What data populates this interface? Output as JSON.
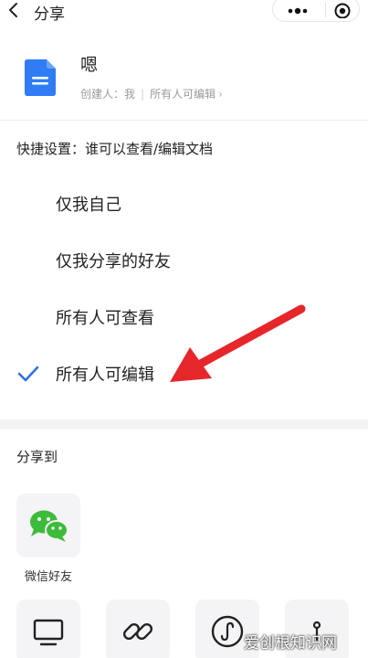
{
  "nav": {
    "title": "分享",
    "back_icon": "chevron-left-icon",
    "more_icon": "more-dots-icon",
    "close_icon": "target-circle-icon"
  },
  "document": {
    "name": "嗯",
    "icon": "doc-file-icon",
    "creator": "创建人：我",
    "permission_summary": "所有人可编辑",
    "colors": {
      "icon_blue": "#2f7cf5",
      "icon_blue_light": "#6aa4ff"
    }
  },
  "quick_settings": {
    "title": "快捷设置：谁可以查看/编辑文档",
    "options": [
      {
        "label": "仅我自己",
        "selected": false
      },
      {
        "label": "仅我分享的好友",
        "selected": false
      },
      {
        "label": "所有人可查看",
        "selected": false
      },
      {
        "label": "所有人可编辑",
        "selected": true
      }
    ],
    "check_color": "#2f6fe8",
    "annotation_arrow_color": "#e5262b"
  },
  "share_to": {
    "title": "分享到",
    "targets": [
      {
        "label": "微信好友",
        "icon": "wechat-icon",
        "color": "#3dbb3a"
      },
      {
        "label": "",
        "icon": "monitor-icon"
      },
      {
        "label": "",
        "icon": "link-icon"
      },
      {
        "label": "",
        "icon": "mini-program-icon"
      },
      {
        "label": "",
        "icon": "pin-icon"
      }
    ]
  },
  "watermark": {
    "text": "爱创根知识网"
  }
}
